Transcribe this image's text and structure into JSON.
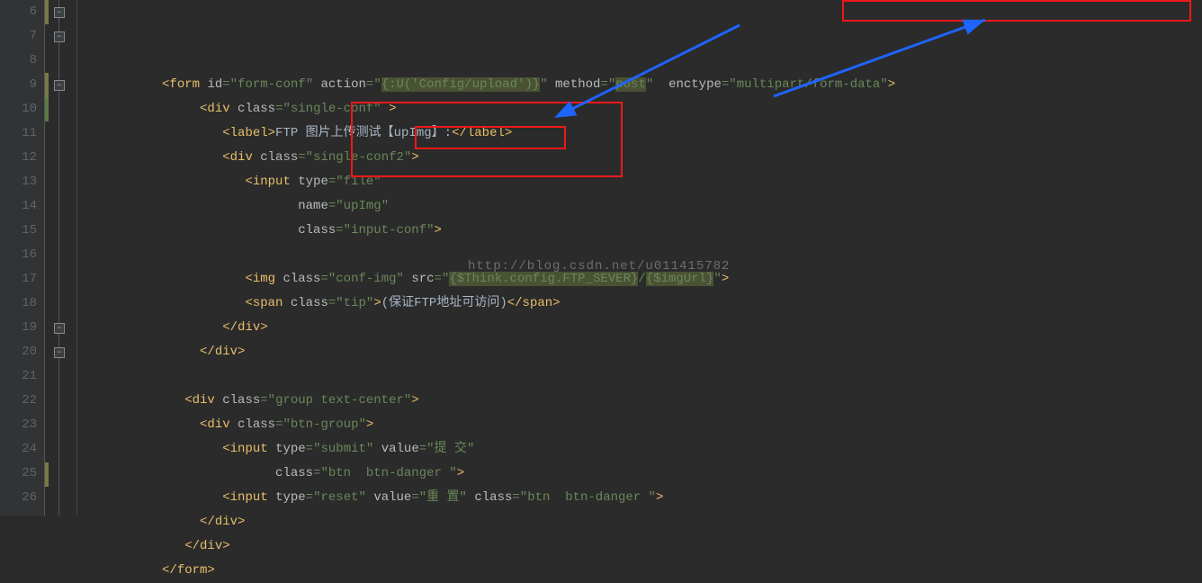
{
  "line_numbers": [
    "6",
    "7",
    "8",
    "9",
    "10",
    "11",
    "12",
    "13",
    "14",
    "15",
    "16",
    "17",
    "18",
    "19",
    "20",
    "21",
    "22",
    "23",
    "24",
    "25",
    "26"
  ],
  "watermark": "http://blog.csdn.net/u011415782",
  "code_lines": {
    "l6": {
      "indent": "          ",
      "parts": [
        {
          "t": "<form",
          "c": "tag"
        },
        {
          "t": " ",
          "c": "text"
        },
        {
          "t": "id",
          "c": "attr-name"
        },
        {
          "t": "=\"",
          "c": "attr-val"
        },
        {
          "t": "form-conf",
          "c": "attr-val"
        },
        {
          "t": "\"",
          "c": "attr-val"
        },
        {
          "t": " ",
          "c": "text"
        },
        {
          "t": "action",
          "c": "attr-name"
        },
        {
          "t": "=\"",
          "c": "attr-val"
        },
        {
          "t": "{:U('Config/",
          "c": "attr-val-hl"
        },
        {
          "t": "upload",
          "c": "attr-val-hl"
        },
        {
          "t": "')}",
          "c": "attr-val-hl"
        },
        {
          "t": "\"",
          "c": "attr-val"
        },
        {
          "t": " ",
          "c": "text"
        },
        {
          "t": "method",
          "c": "attr-name"
        },
        {
          "t": "=\"",
          "c": "attr-val"
        },
        {
          "t": "post",
          "c": "attr-val-hl"
        },
        {
          "t": "\"",
          "c": "attr-val"
        },
        {
          "t": "  ",
          "c": "text"
        },
        {
          "t": "enctype",
          "c": "attr-name"
        },
        {
          "t": "=\"",
          "c": "attr-val"
        },
        {
          "t": "multipart/form-data",
          "c": "attr-val"
        },
        {
          "t": "\"",
          "c": "attr-val"
        },
        {
          "t": ">",
          "c": "tag"
        }
      ]
    },
    "l7": {
      "indent": "               ",
      "parts": [
        {
          "t": "<div",
          "c": "tag"
        },
        {
          "t": " ",
          "c": "text"
        },
        {
          "t": "class",
          "c": "attr-name"
        },
        {
          "t": "=\"",
          "c": "attr-val"
        },
        {
          "t": "single-conf",
          "c": "attr-val"
        },
        {
          "t": "\"",
          "c": "attr-val"
        },
        {
          "t": " >",
          "c": "tag"
        }
      ]
    },
    "l8": {
      "indent": "                  ",
      "parts": [
        {
          "t": "<label>",
          "c": "tag"
        },
        {
          "t": "FTP 图片上传测试【upImg】:",
          "c": "text"
        },
        {
          "t": "</label>",
          "c": "tag"
        }
      ]
    },
    "l9": {
      "indent": "                  ",
      "parts": [
        {
          "t": "<div",
          "c": "tag"
        },
        {
          "t": " ",
          "c": "text"
        },
        {
          "t": "class",
          "c": "attr-name"
        },
        {
          "t": "=\"",
          "c": "attr-val"
        },
        {
          "t": "single-conf2",
          "c": "attr-val"
        },
        {
          "t": "\"",
          "c": "attr-val"
        },
        {
          "t": ">",
          "c": "tag"
        }
      ]
    },
    "l10": {
      "indent": "                     ",
      "parts": [
        {
          "t": "<input",
          "c": "tag"
        },
        {
          "t": " ",
          "c": "text"
        },
        {
          "t": "type",
          "c": "attr-name"
        },
        {
          "t": "=\"",
          "c": "attr-val"
        },
        {
          "t": "file",
          "c": "attr-val"
        },
        {
          "t": "\"",
          "c": "attr-val"
        }
      ]
    },
    "l11": {
      "indent": "                            ",
      "parts": [
        {
          "t": "name",
          "c": "attr-name"
        },
        {
          "t": "=\"",
          "c": "attr-val"
        },
        {
          "t": "upImg",
          "c": "attr-val"
        },
        {
          "t": "\"",
          "c": "attr-val"
        }
      ]
    },
    "l12": {
      "indent": "                            ",
      "parts": [
        {
          "t": "class",
          "c": "attr-name"
        },
        {
          "t": "=\"",
          "c": "attr-val"
        },
        {
          "t": "input-conf",
          "c": "attr-val"
        },
        {
          "t": "\"",
          "c": "attr-val"
        },
        {
          "t": ">",
          "c": "tag"
        }
      ]
    },
    "l13": {
      "indent": "",
      "parts": []
    },
    "l14": {
      "indent": "                     ",
      "parts": [
        {
          "t": "<img",
          "c": "tag"
        },
        {
          "t": " ",
          "c": "text"
        },
        {
          "t": "class",
          "c": "attr-name"
        },
        {
          "t": "=\"",
          "c": "attr-val"
        },
        {
          "t": "conf-img",
          "c": "attr-val"
        },
        {
          "t": "\"",
          "c": "attr-val"
        },
        {
          "t": " ",
          "c": "text"
        },
        {
          "t": "src",
          "c": "attr-name"
        },
        {
          "t": "=\"",
          "c": "attr-val"
        },
        {
          "t": "{$Think.config.FTP_SEVER}",
          "c": "attr-val-hl"
        },
        {
          "t": "/",
          "c": "attr-val"
        },
        {
          "t": "{$imgUrl}",
          "c": "attr-val-hl"
        },
        {
          "t": "\"",
          "c": "attr-val"
        },
        {
          "t": ">",
          "c": "tag"
        }
      ]
    },
    "l15": {
      "indent": "                     ",
      "parts": [
        {
          "t": "<span",
          "c": "tag"
        },
        {
          "t": " ",
          "c": "text"
        },
        {
          "t": "class",
          "c": "attr-name"
        },
        {
          "t": "=\"",
          "c": "attr-val"
        },
        {
          "t": "tip",
          "c": "attr-val"
        },
        {
          "t": "\"",
          "c": "attr-val"
        },
        {
          "t": ">",
          "c": "tag"
        },
        {
          "t": "(保证FTP地址可访问)",
          "c": "text"
        },
        {
          "t": "</span>",
          "c": "tag"
        }
      ]
    },
    "l16": {
      "indent": "                  ",
      "parts": [
        {
          "t": "</div>",
          "c": "tag"
        }
      ]
    },
    "l17": {
      "indent": "               ",
      "parts": [
        {
          "t": "</div>",
          "c": "tag"
        }
      ]
    },
    "l18": {
      "indent": "",
      "parts": []
    },
    "l19": {
      "indent": "             ",
      "parts": [
        {
          "t": "<div",
          "c": "tag"
        },
        {
          "t": " ",
          "c": "text"
        },
        {
          "t": "class",
          "c": "attr-name"
        },
        {
          "t": "=\"",
          "c": "attr-val"
        },
        {
          "t": "group text-center",
          "c": "attr-val"
        },
        {
          "t": "\"",
          "c": "attr-val"
        },
        {
          "t": ">",
          "c": "tag"
        }
      ]
    },
    "l20": {
      "indent": "               ",
      "parts": [
        {
          "t": "<div",
          "c": "tag"
        },
        {
          "t": " ",
          "c": "text"
        },
        {
          "t": "class",
          "c": "attr-name"
        },
        {
          "t": "=\"",
          "c": "attr-val"
        },
        {
          "t": "btn-group",
          "c": "attr-val"
        },
        {
          "t": "\"",
          "c": "attr-val"
        },
        {
          "t": ">",
          "c": "tag"
        }
      ]
    },
    "l21": {
      "indent": "                  ",
      "parts": [
        {
          "t": "<input",
          "c": "tag"
        },
        {
          "t": " ",
          "c": "text"
        },
        {
          "t": "type",
          "c": "attr-name"
        },
        {
          "t": "=\"",
          "c": "attr-val"
        },
        {
          "t": "submit",
          "c": "attr-val"
        },
        {
          "t": "\"",
          "c": "attr-val"
        },
        {
          "t": " ",
          "c": "text"
        },
        {
          "t": "value",
          "c": "attr-name"
        },
        {
          "t": "=\"",
          "c": "attr-val"
        },
        {
          "t": "提 交",
          "c": "attr-val"
        },
        {
          "t": "\"",
          "c": "attr-val"
        }
      ]
    },
    "l22": {
      "indent": "                         ",
      "parts": [
        {
          "t": "class",
          "c": "attr-name"
        },
        {
          "t": "=\"",
          "c": "attr-val"
        },
        {
          "t": "btn  btn-danger ",
          "c": "attr-val"
        },
        {
          "t": "\"",
          "c": "attr-val"
        },
        {
          "t": ">",
          "c": "tag"
        }
      ]
    },
    "l23": {
      "indent": "                  ",
      "parts": [
        {
          "t": "<input",
          "c": "tag"
        },
        {
          "t": " ",
          "c": "text"
        },
        {
          "t": "type",
          "c": "attr-name"
        },
        {
          "t": "=\"",
          "c": "attr-val"
        },
        {
          "t": "reset",
          "c": "attr-val"
        },
        {
          "t": "\"",
          "c": "attr-val"
        },
        {
          "t": " ",
          "c": "text"
        },
        {
          "t": "value",
          "c": "attr-name"
        },
        {
          "t": "=\"",
          "c": "attr-val"
        },
        {
          "t": "重 置",
          "c": "attr-val"
        },
        {
          "t": "\"",
          "c": "attr-val"
        },
        {
          "t": " ",
          "c": "text"
        },
        {
          "t": "class",
          "c": "attr-name"
        },
        {
          "t": "=\"",
          "c": "attr-val"
        },
        {
          "t": "btn  btn-danger ",
          "c": "attr-val"
        },
        {
          "t": "\"",
          "c": "attr-val"
        },
        {
          "t": ">",
          "c": "tag"
        }
      ]
    },
    "l24": {
      "indent": "               ",
      "parts": [
        {
          "t": "</div>",
          "c": "tag"
        }
      ]
    },
    "l25": {
      "indent": "             ",
      "parts": [
        {
          "t": "</div>",
          "c": "tag"
        }
      ]
    },
    "l26": {
      "indent": "          ",
      "parts": [
        {
          "t": "</form>",
          "c": "tag"
        }
      ]
    }
  }
}
